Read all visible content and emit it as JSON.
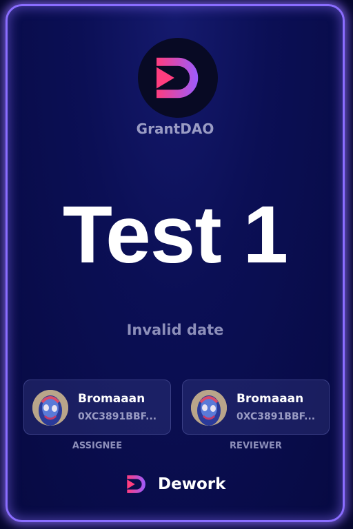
{
  "card": {
    "org_name": "GrantDAO",
    "title": "Test 1",
    "date": "Invalid date"
  },
  "assignee": {
    "name": "Bromaaan",
    "address": "0XC3891BBF...",
    "role": "ASSIGNEE"
  },
  "reviewer": {
    "name": "Bromaaan",
    "address": "0XC3891BBF...",
    "role": "REVIEWER"
  },
  "brand": {
    "name": "Dework",
    "icon": "dework-logo-icon"
  },
  "colors": {
    "background": "#070a42",
    "border_glow": "#8a6dff",
    "logo_gradient_start": "#ff3d7f",
    "logo_gradient_end": "#9b5cff",
    "muted_text": "#9a9cc4"
  }
}
